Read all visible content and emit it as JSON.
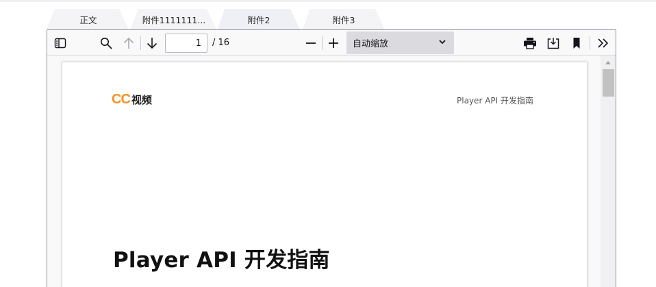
{
  "tabs": [
    {
      "label": "正文"
    },
    {
      "label": "附件1111111..."
    },
    {
      "label": "附件2",
      "active": true
    },
    {
      "label": "附件3"
    }
  ],
  "toolbar": {
    "sidebar_toggle_icon": "sidebar-icon",
    "find_icon": "search-icon",
    "prev_icon": "arrow-up-icon",
    "next_icon": "arrow-down-icon",
    "page_number": "1",
    "page_total": "/ 16",
    "zoom_out_icon": "minus-icon",
    "zoom_in_icon": "plus-icon",
    "zoom_value": "自动缩放",
    "print_icon": "printer-icon",
    "download_icon": "download-icon",
    "bookmark_icon": "bookmark-icon",
    "more_tools_icon": "double-chevron-right-icon"
  },
  "document": {
    "logo_cc": "CC",
    "logo_text": "视频",
    "header_right": "Player API 开发指南",
    "title": "Player API 开发指南"
  },
  "colors": {
    "logo_accent": "#f39322",
    "toolbar_bg": "#f9f9fa",
    "active_tab_bg": "#eef0f5",
    "inactive_tab_bg": "#f4f4f6"
  }
}
